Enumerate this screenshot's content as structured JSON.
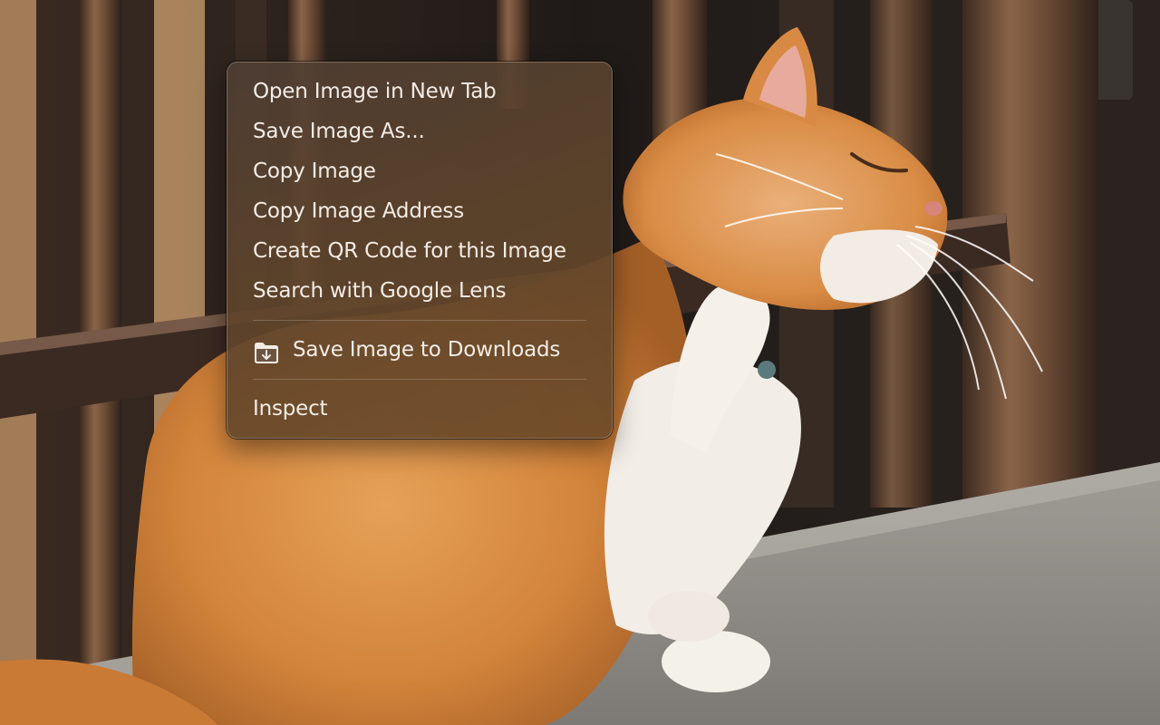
{
  "background": {
    "subject": "orange and white cat scratching its chin beside a metal railing",
    "colors": {
      "fur": "#d9883a",
      "railing": "#5a3f2e",
      "stone": "#8f8b86"
    }
  },
  "context_menu": {
    "items": [
      {
        "label": "Open Image in New Tab"
      },
      {
        "label": "Save Image As..."
      },
      {
        "label": "Copy Image"
      },
      {
        "label": "Copy Image Address"
      },
      {
        "label": "Create QR Code for this Image"
      },
      {
        "label": "Search with Google Lens"
      }
    ],
    "save_to_downloads": {
      "label": "Save Image to Downloads",
      "icon": "download-folder-icon"
    },
    "inspect": {
      "label": "Inspect"
    },
    "colors": {
      "background": "#5e4632",
      "text": "#f3ece6",
      "separator": "#8a7664"
    }
  }
}
